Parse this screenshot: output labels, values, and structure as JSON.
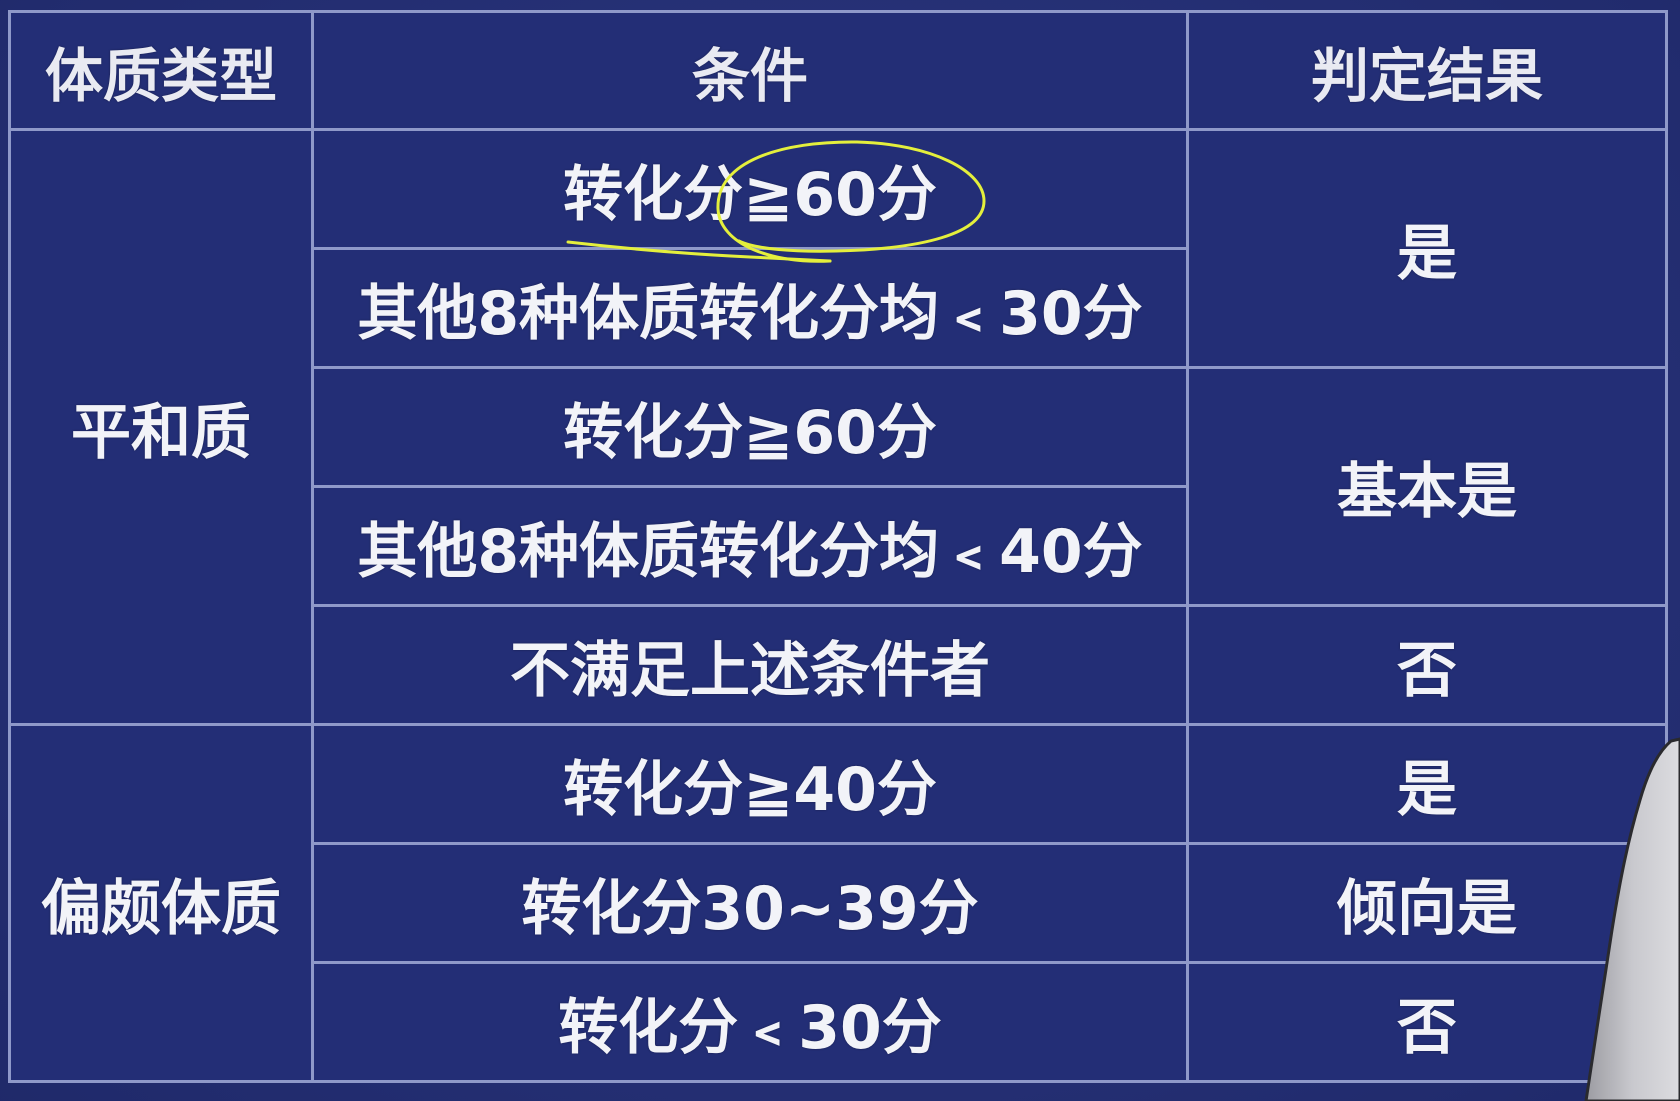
{
  "table": {
    "headers": {
      "type": "体质类型",
      "condition": "条件",
      "result": "判定结果"
    },
    "groups": [
      {
        "type": "平和质",
        "conditions": [
          "转化分≧60分",
          "其他8种体质转化分均﹤30分",
          "转化分≧60分",
          "其他8种体质转化分均﹤40分",
          "不满足上述条件者"
        ],
        "results": [
          "是",
          "基本是",
          "否"
        ]
      },
      {
        "type": "偏颇体质",
        "conditions": [
          "转化分≧40分",
          "转化分30~39分",
          "转化分﹤30分"
        ],
        "results": [
          "是",
          "倾向是",
          "否"
        ]
      }
    ]
  },
  "colors": {
    "background": "#232e76",
    "grid_line": "#8f99c9",
    "text": "#f2f3f8",
    "annotation": "#e4ef3c"
  }
}
